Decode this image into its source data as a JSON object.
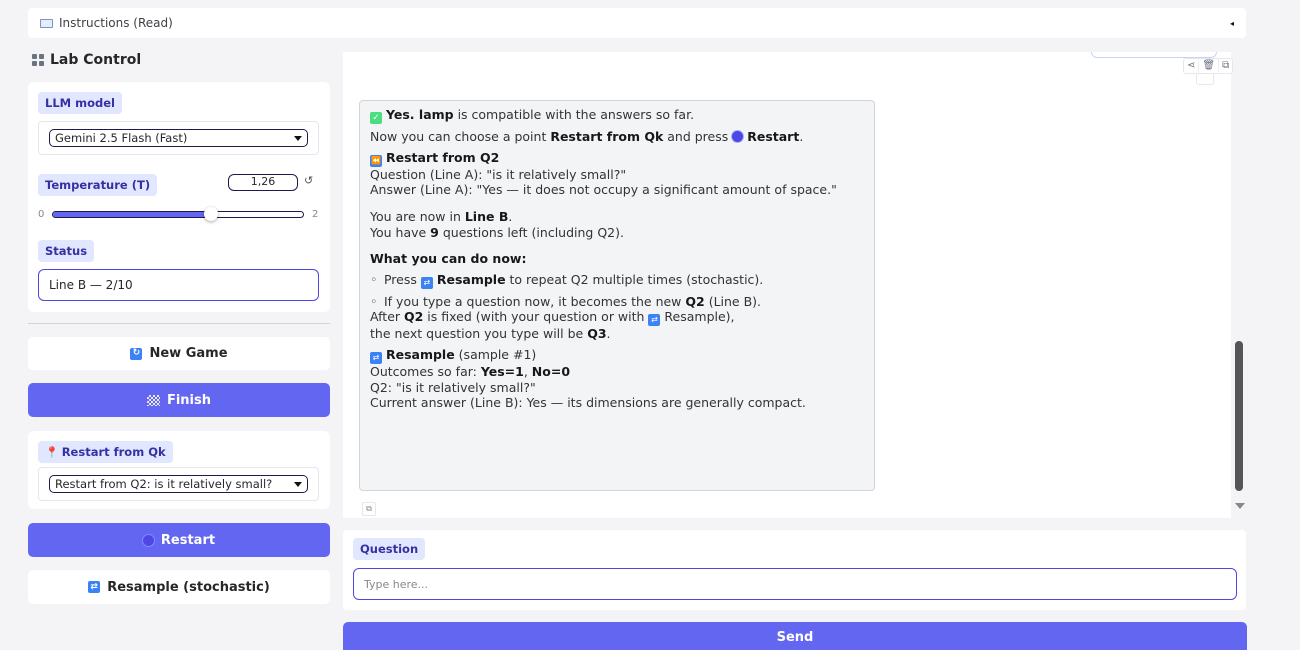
{
  "accordion": {
    "label": "Instructions (Read)",
    "icon": "book-icon"
  },
  "sidebar": {
    "title": "Lab Control",
    "llm": {
      "label": "LLM model",
      "value": "Gemini 2.5 Flash (Fast)"
    },
    "temperature": {
      "label": "Temperature (T)",
      "value": "1,26",
      "min": "0",
      "max": "2",
      "fraction": 0.63
    },
    "status": {
      "label": "Status",
      "value": "Line B — 2/10"
    },
    "new_game": "New Game",
    "finish": "Finish",
    "restart_from": {
      "label": "Restart from Qk",
      "value": "Restart from Q2: is it relatively small?"
    },
    "restart": "Restart",
    "resample": "Resample (stochastic)"
  },
  "chat": {
    "l1b": "Yes. lamp",
    "l1": " is compatible with the answers so far.",
    "l2a": "Now you can choose a point ",
    "l2b": "Restart from Qk",
    "l2c": " and press ",
    "l2d": "Restart",
    "l2e": ".",
    "h1": "Restart from Q2",
    "q_line_a": "Question (Line A): \"is it relatively small?\"",
    "a_line_a": "Answer (Line A): \"Yes — it does not occupy a significant amount of space.\"",
    "l3a": "You are now in ",
    "l3b": "Line B",
    "l3c": ".",
    "l4a": "You have ",
    "l4b": "9",
    "l4c": " questions left (including Q2).",
    "h2": "What you can do now:",
    "b1a": "Press ",
    "b1b": "Resample",
    "b1c": " to repeat Q2 multiple times (stochastic).",
    "b2a": "If you type a question now, it becomes the new ",
    "b2b": "Q2",
    "b2c": " (Line B).",
    "l5a": "After ",
    "l5b": "Q2",
    "l5c": " is fixed (with your question or with ",
    "l5d": " Resample),",
    "l6a": "the next question you type will be ",
    "l6b": "Q3",
    "l6c": ".",
    "h3": "Resample",
    "h3b": " (sample #1)",
    "l7a": "Outcomes so far: ",
    "l7b": "Yes=1",
    "l7c": ", ",
    "l7d": "No=0",
    "l8": "Q2: \"is it relatively small?\"",
    "l9": "Current answer (Line B): Yes — its dimensions are generally compact."
  },
  "question": {
    "label": "Question",
    "placeholder": "Type here..."
  },
  "send": "Send",
  "colors": {
    "accent": "#6366f1",
    "chip_bg": "#e0e7ff",
    "chip_text": "#3730a3"
  }
}
